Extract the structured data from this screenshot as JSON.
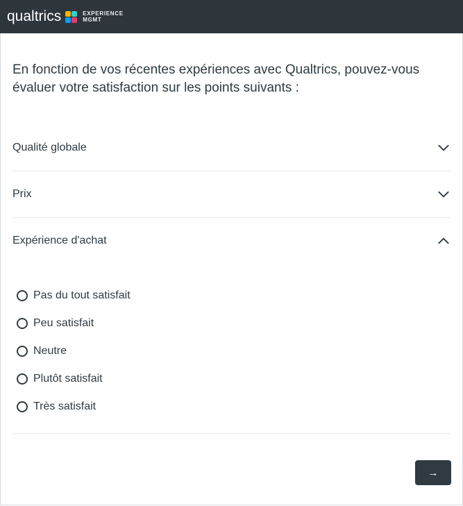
{
  "header": {
    "logo_word": "qualtrics",
    "logo_sub_line1": "EXPERIENCE",
    "logo_sub_line2": "MGMT"
  },
  "question_text": "En fonction de vos récentes expériences avec Qualtrics, pouvez-vous évaluer votre satisfaction sur les points suivants :",
  "accordion": {
    "items": [
      {
        "label": "Qualité globale",
        "open": false
      },
      {
        "label": "Prix",
        "open": false
      },
      {
        "label": "Expérience d'achat",
        "open": true
      }
    ]
  },
  "scale_options": [
    "Pas du tout satisfait",
    "Peu satisfait",
    "Neutre",
    "Plutôt satisfait",
    "Très satisfait"
  ],
  "next_button": {
    "glyph": "→"
  },
  "colors": {
    "header_bg": "#2e353b",
    "text": "#2e3a42",
    "border": "#e4e8eb"
  }
}
